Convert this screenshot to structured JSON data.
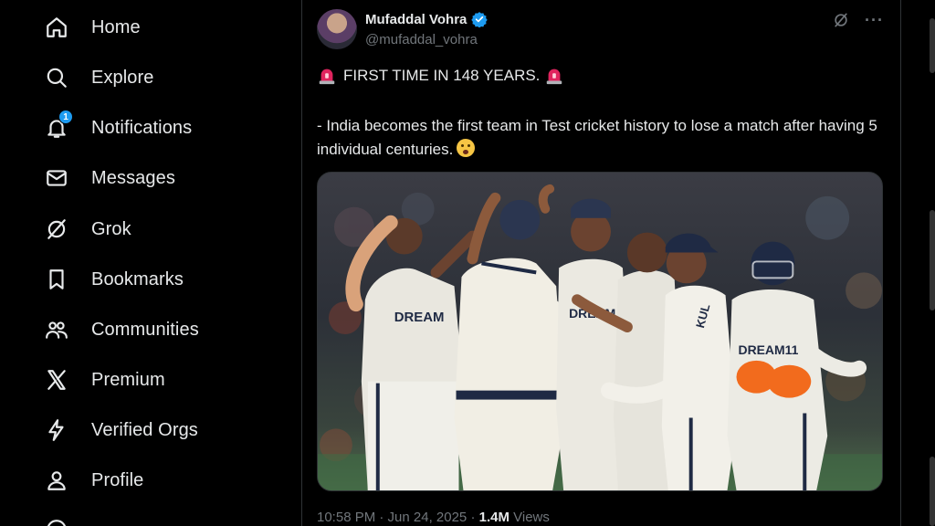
{
  "nav": {
    "items": [
      {
        "label": "Home",
        "icon": "home-icon"
      },
      {
        "label": "Explore",
        "icon": "search-icon"
      },
      {
        "label": "Notifications",
        "icon": "bell-icon",
        "badge": "1"
      },
      {
        "label": "Messages",
        "icon": "envelope-icon"
      },
      {
        "label": "Grok",
        "icon": "grok-icon"
      },
      {
        "label": "Bookmarks",
        "icon": "bookmark-icon"
      },
      {
        "label": "Communities",
        "icon": "people-icon"
      },
      {
        "label": "Premium",
        "icon": "x-logo-icon"
      },
      {
        "label": "Verified Orgs",
        "icon": "lightning-icon"
      },
      {
        "label": "Profile",
        "icon": "person-icon"
      }
    ]
  },
  "tweet": {
    "author_name": "Mufaddal Vohra",
    "author_handle": "@mufaddal_vohra",
    "headline": "FIRST TIME IN 148 YEARS.",
    "body": "- India becomes the first team in Test cricket history to lose a match after having 5 individual centuries.",
    "timestamp": "10:58 PM · Jun 24, 2025 · ",
    "views_count": "1.4M",
    "views_label": " Views",
    "jersey_texts": [
      "DREAM",
      "DREAM",
      "DREAM11",
      "KUL"
    ]
  },
  "colors": {
    "background": "#000000",
    "text_primary": "#e7e9ea",
    "text_secondary": "#71767b",
    "accent_blue": "#1d9bf0",
    "divider": "#2f3336"
  }
}
